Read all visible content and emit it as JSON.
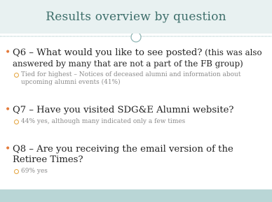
{
  "slide": {
    "title": "Results overview by question",
    "items": [
      {
        "question": "Q6 – What would you like to see posted?",
        "note": " (this was also answered by many that are not a part of the FB group)",
        "detail": "Tied for highest – Notices of deceased alumni and information about upcoming alumni events (41%)"
      },
      {
        "question": "Q7 – Have you visited SDG&E Alumni website?",
        "detail": "44% yes, although many indicated only a few times"
      },
      {
        "question": "Q8 – Are you receiving the email version of the Retiree Times?",
        "detail": "69% yes"
      }
    ]
  },
  "colors": {
    "title": "#3d6e6a",
    "title_band": "#e8f1f1",
    "bullet": "#e47a3a",
    "sub_bullet": "#e4a23a",
    "bottom_band": "#b9d6d6"
  }
}
